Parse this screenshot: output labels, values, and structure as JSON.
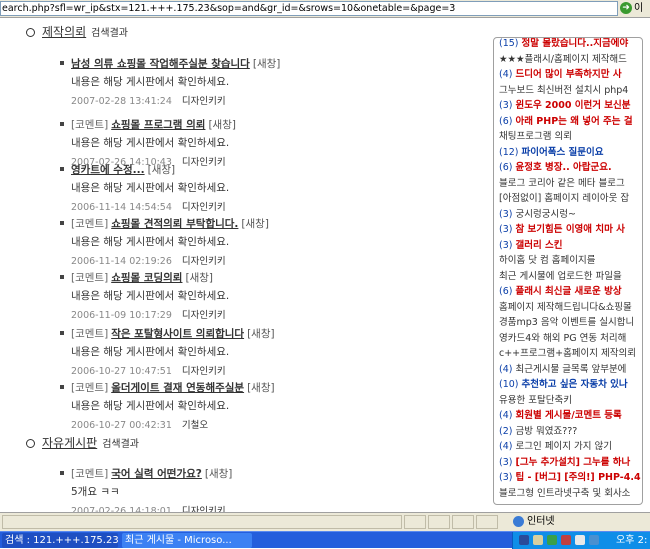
{
  "addressbar": {
    "url": "earch.php?sfl=wr_ip&stx=121.+++.175.23&sop=and&gr_id=&srows=10&onetable=&page=3",
    "go_label": "이"
  },
  "sections": [
    {
      "title": "제작의뢰",
      "subtitle": "검색결과",
      "posts": [
        {
          "tag": "",
          "title": "남성 의류 쇼핑몰 작업해주실분 찾습니다",
          "new": "[새창]",
          "body": "내용은 해당 게시판에서 확인하세요.",
          "date": "2007-02-28 13:41:24",
          "author": "디자인키키"
        },
        {
          "tag": "[코멘트]",
          "title": "쇼핑몰 프로그램 의뢰",
          "new": "[새창]",
          "body": "내용은 해당 게시판에서 확인하세요.",
          "date": "2007-02-26 14:10:43",
          "author": "디자인키키"
        },
        {
          "tag": "",
          "title": "영카트에 수정...",
          "new": "[새창]",
          "body": "내용은 해당 게시판에서 확인하세요.",
          "date": "2006-11-14 14:54:54",
          "author": "디자인키키"
        },
        {
          "tag": "[코멘트]",
          "title": "쇼핑몰 견적의뢰 부탁합니다.",
          "new": "[새창]",
          "body": "내용은 해당 게시판에서 확인하세요.",
          "date": "2006-11-14 02:19:26",
          "author": "디자인키키"
        },
        {
          "tag": "[코멘트]",
          "title": "쇼핑몰 코딩의뢰",
          "new": "[새창]",
          "body": "내용은 해당 게시판에서 확인하세요.",
          "date": "2006-11-09 10:17:29",
          "author": "디자인키키"
        },
        {
          "tag": "[코멘트]",
          "title": "작은 포탈형사이트 의뢰합니다",
          "new": "[새창]",
          "body": "내용은 해당 게시판에서 확인하세요.",
          "date": "2006-10-27 10:47:51",
          "author": "디자인키키"
        },
        {
          "tag": "[코멘트]",
          "title": "올더게이트 결재 연동해주실분",
          "new": "[새창]",
          "body": "내용은 해당 게시판에서 확인하세요.",
          "date": "2006-10-27 00:42:31",
          "author": "기철오"
        }
      ]
    },
    {
      "title": "자유게시판",
      "subtitle": "검색결과",
      "posts": [
        {
          "tag": "[코멘트]",
          "title": "국어 실력 어떤가요?",
          "new": "[새창]",
          "body": "5개요 ㅋㅋ",
          "date": "2007-02-26 14:18:01",
          "author": "디자인키키"
        }
      ]
    }
  ],
  "sidebar": [
    {
      "num": "(15)",
      "text": "정말 몰랐습니다..지금에야",
      "style": "hot"
    },
    {
      "num": "",
      "text": "★★★플래시/홈페이지 제작해드",
      "style": "plain"
    },
    {
      "num": "(4)",
      "text": "드디어 많이 부족하지만 사",
      "style": "hot"
    },
    {
      "num": "",
      "text": "그누보드 최신버전 설치시 php4",
      "style": "plain"
    },
    {
      "num": "(3)",
      "text": "윈도우 2000 이런거 보신분",
      "style": "hot"
    },
    {
      "num": "(6)",
      "text": "아래 PHP는 왜 넣어 주는 걸",
      "style": "hot"
    },
    {
      "num": "",
      "text": "채팅프로그램 의뢰",
      "style": "plain"
    },
    {
      "num": "(12)",
      "text": "파이어폭스 질문이요",
      "style": "blue"
    },
    {
      "num": "(6)",
      "text": "윤정호 병장.. 아랍군요.",
      "style": "hot"
    },
    {
      "num": "",
      "text": "블로그 코리아 같은 메타 블로그",
      "style": "plain"
    },
    {
      "num": "",
      "text": "[아점없이] 홈페이지 레이아웃 잡",
      "style": "plain"
    },
    {
      "num": "(3)",
      "text": "궁시렁궁시렁~",
      "style": "plain"
    },
    {
      "num": "(3)",
      "text": "참 보기힘든 이영애 치마 사",
      "style": "hot"
    },
    {
      "num": "(3)",
      "text": "갤러리 스킨",
      "style": "hot"
    },
    {
      "num": "",
      "text": "하이홈 닷 컴 홈페이지를",
      "style": "plain"
    },
    {
      "num": "",
      "text": "최근 게시물에 업로드한 파일을",
      "style": "plain"
    },
    {
      "num": "(6)",
      "text": "플래시 최신글 새로운 방상",
      "style": "hot"
    },
    {
      "num": "",
      "text": "홈페이지 제작해드립니다&쇼핑몰",
      "style": "plain"
    },
    {
      "num": "",
      "text": "경품mp3 음악 이벤트를 실시합니",
      "style": "plain"
    },
    {
      "num": "",
      "text": "영카드4와 해외 PG 연동 처리해",
      "style": "plain"
    },
    {
      "num": "",
      "text": "c++프로그램+홈페이지 제작의뢰",
      "style": "plain"
    },
    {
      "num": "(4)",
      "text": "최근게시물 글목록 앞부분에",
      "style": "plain"
    },
    {
      "num": "(10)",
      "text": "추천하고 싶은 자동차 있나",
      "style": "blue"
    },
    {
      "num": "",
      "text": "유용한 포탈단축키",
      "style": "plain"
    },
    {
      "num": "(4)",
      "text": "회원별 게시물/코멘트 등록",
      "style": "hot"
    },
    {
      "num": "(2)",
      "text": "금방 뭐였죠???",
      "style": "plain"
    },
    {
      "num": "(4)",
      "text": "로그인 페이지 가지 않기",
      "style": "plain"
    },
    {
      "num": "(3)",
      "text": "[그누 추가설치] 그누를 하나",
      "style": "hot"
    },
    {
      "num": "(3)",
      "text": "팁 - [버그] [주의!] PHP-4.4",
      "style": "hot"
    },
    {
      "num": "",
      "text": "블로그형 인트라넷구축 및 회사소",
      "style": "plain"
    }
  ],
  "statusbar": {
    "zone": "인터넷"
  },
  "taskbar": {
    "items": [
      {
        "label": "검색 : 121.+++.175.23...",
        "active": true
      },
      {
        "label": "최근 게시물 - Microso...",
        "active": false
      }
    ],
    "clock": "오후 2:"
  }
}
